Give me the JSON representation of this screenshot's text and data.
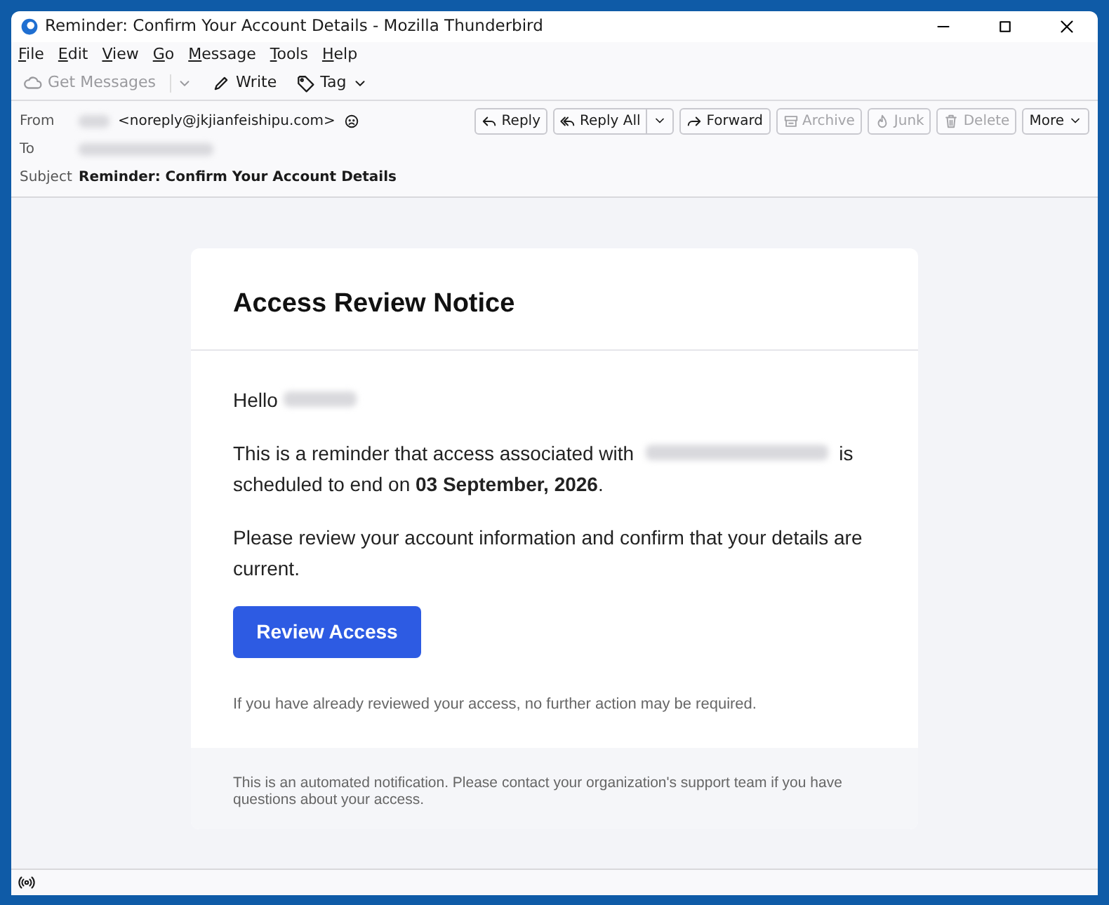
{
  "window": {
    "title": "Reminder: Confirm Your Account Details - Mozilla Thunderbird"
  },
  "menu": [
    {
      "label": "File"
    },
    {
      "label": "Edit"
    },
    {
      "label": "View"
    },
    {
      "label": "Go"
    },
    {
      "label": "Message"
    },
    {
      "label": "Tools"
    },
    {
      "label": "Help"
    }
  ],
  "toolbar": [
    {
      "kind": "get",
      "label": "Get Messages",
      "disabled": true
    },
    {
      "kind": "write",
      "label": "Write",
      "disabled": false
    },
    {
      "kind": "tag",
      "label": "Tag",
      "disabled": false
    }
  ],
  "header": {
    "from_label": "From",
    "from_address": "<noreply@jkjianfeishipu.com>",
    "from_redacted": true,
    "to_label": "To",
    "to_redacted": true,
    "subject_label": "Subject",
    "subject": "Reminder: Confirm Your Account Details"
  },
  "actions": [
    {
      "kind": "reply",
      "label": "Reply",
      "disabled": false
    },
    {
      "kind": "replyall",
      "label": "Reply All",
      "disabled": false
    },
    {
      "kind": "forward",
      "label": "Forward",
      "disabled": false
    },
    {
      "kind": "archive",
      "label": "Archive",
      "disabled": true
    },
    {
      "kind": "junk",
      "label": "Junk",
      "disabled": true
    },
    {
      "kind": "delete",
      "label": "Delete",
      "disabled": true
    },
    {
      "kind": "more",
      "label": "More",
      "disabled": false
    }
  ],
  "email": {
    "heading": "Access Review Notice",
    "greeting": "Hello",
    "greeting_redacted": true,
    "paragraph_1a": "This is a reminder that access associated with",
    "paragraph_1b": "is scheduled to end on **03 September, 2026**.",
    "paragraph_2": "Please review your account information and confirm that your details are current.",
    "button": "Review Access",
    "note": "If you have already reviewed your access, no further action may be required.",
    "footer": "This is an automated notification. Please contact your organization's support team if you have questions about your access."
  }
}
